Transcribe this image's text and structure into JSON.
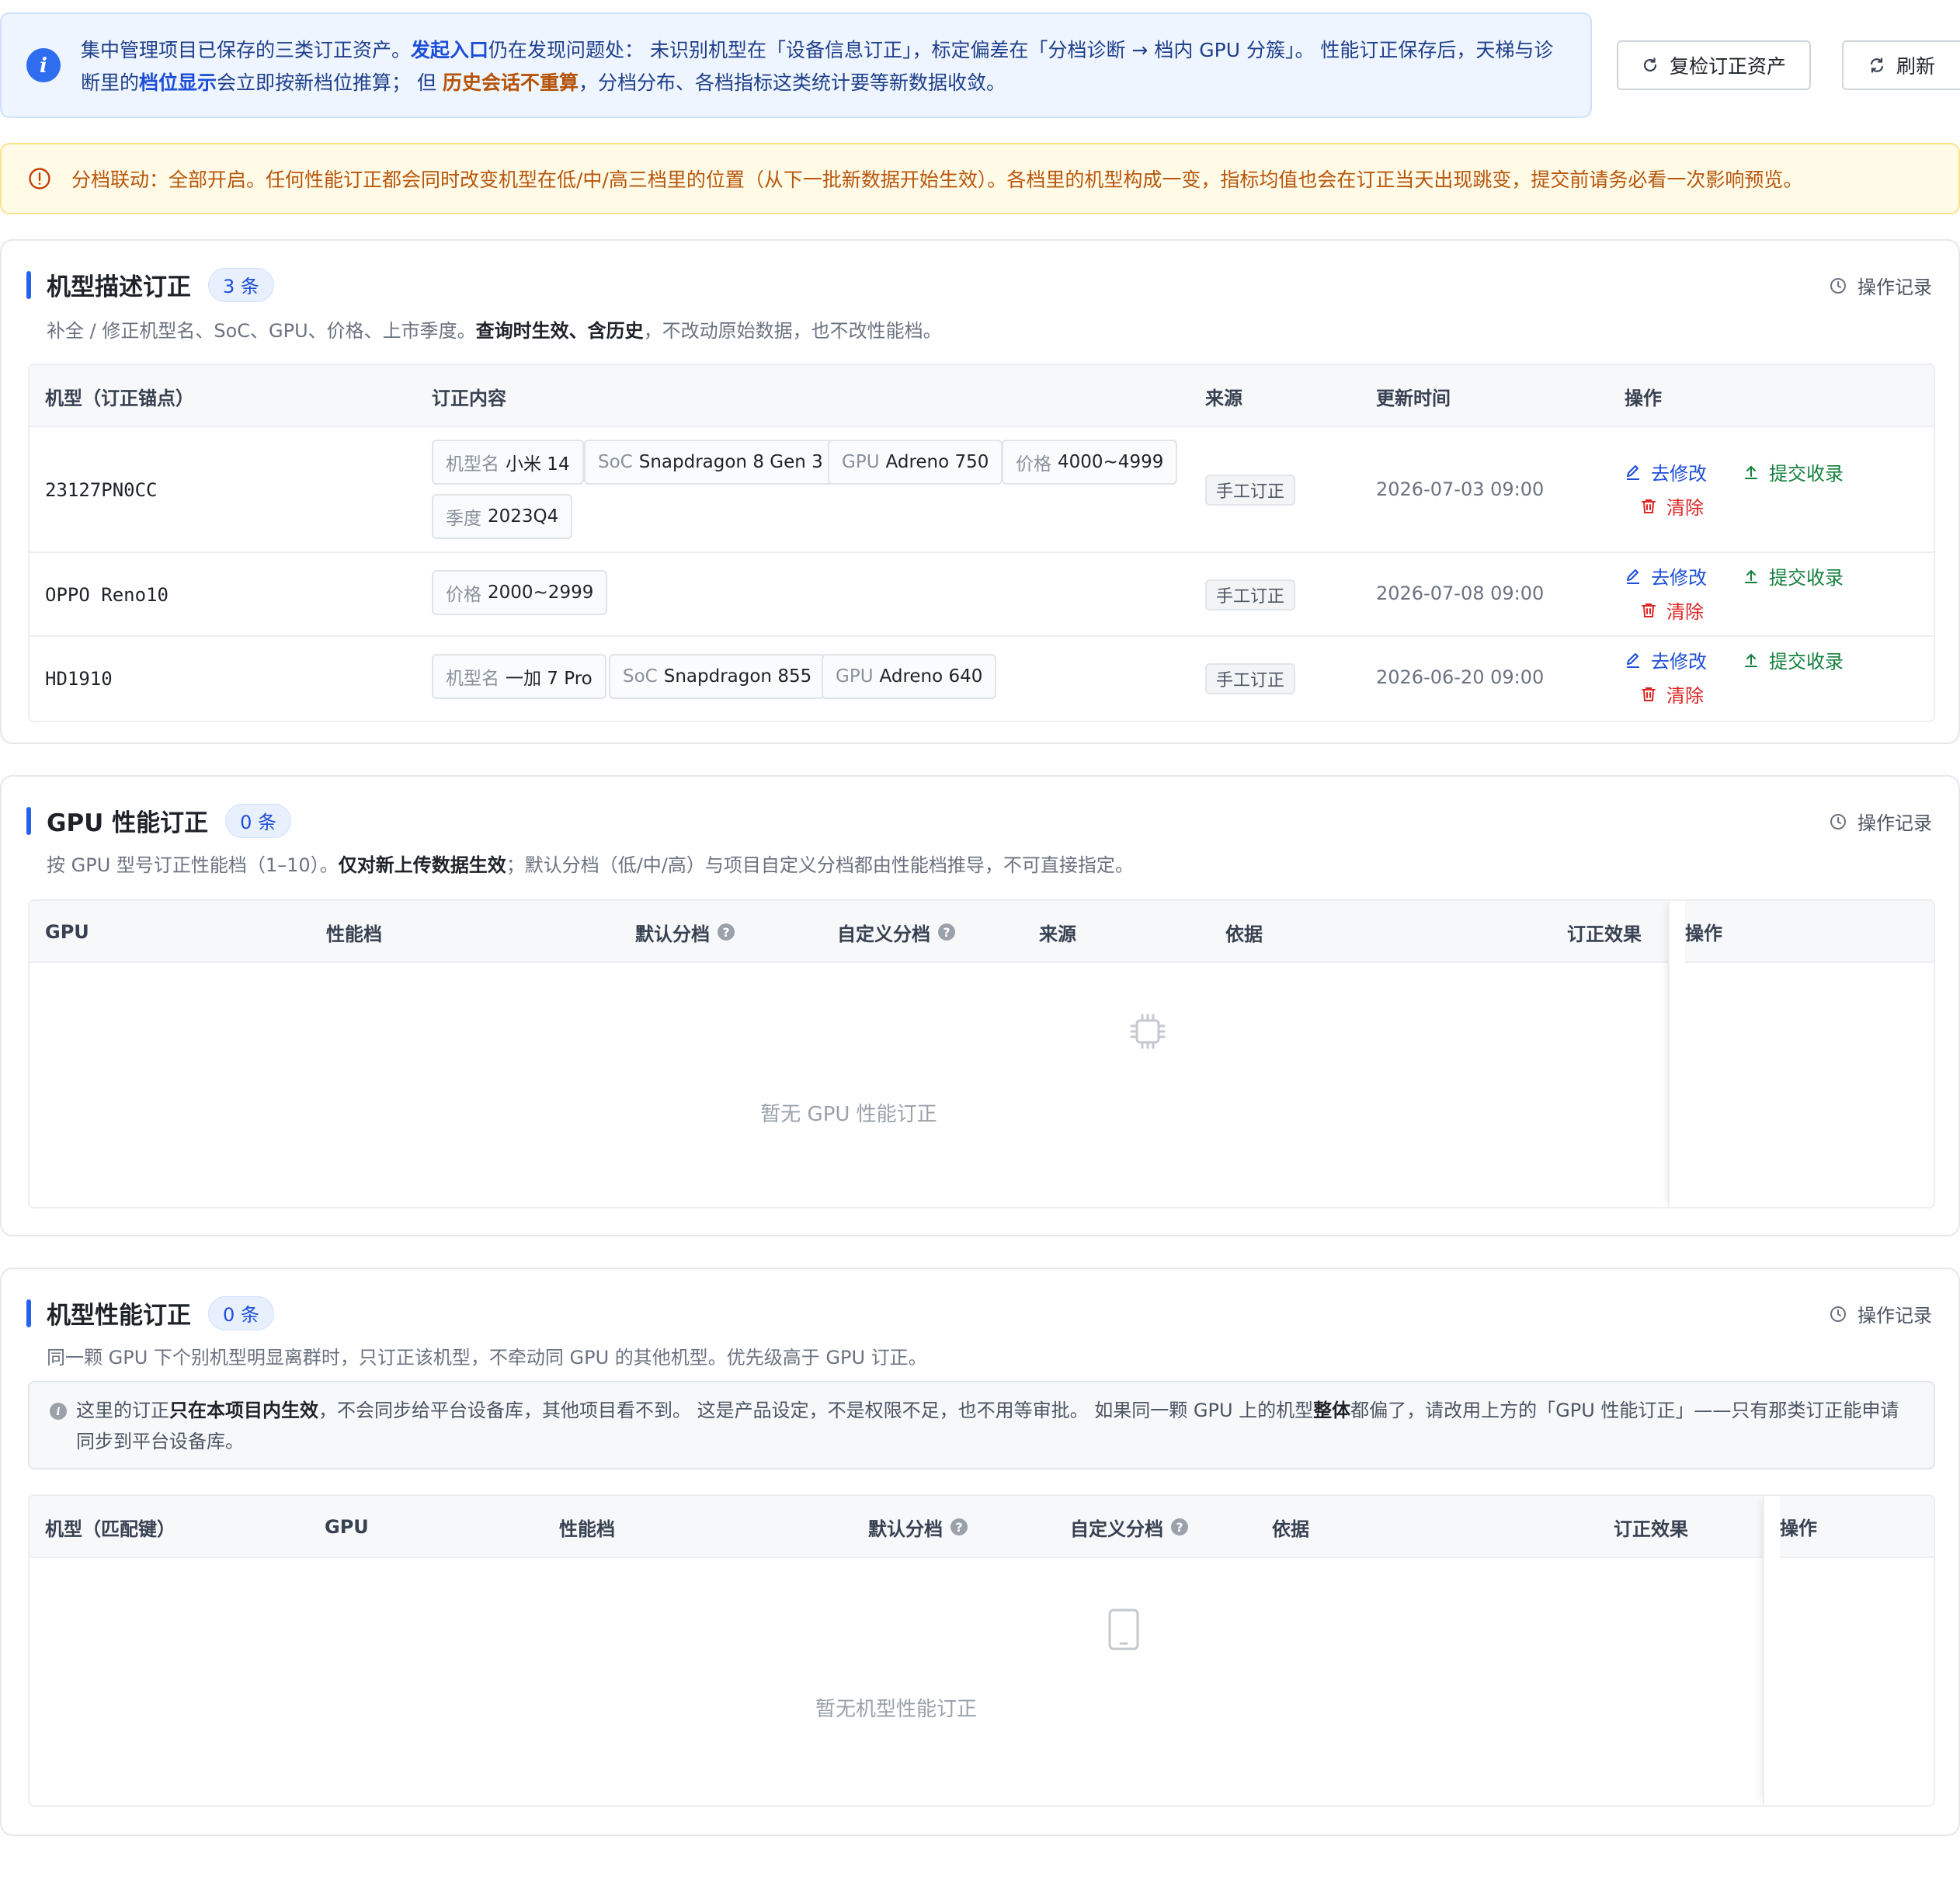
{
  "banner": {
    "p1": "集中管理项目已保存的三类订正资产。",
    "p2": "发起入口",
    "p3": "仍在发现问题处：  未识别机型在「设备信息订正」，标定偏差在「分档诊断 → 档内 GPU 分簇」。 性能订正保存后，天梯与诊断里的",
    "p4": "档位显示",
    "p5": "会立即按新档位推算；  但 ",
    "p6": "历史会话不重算",
    "p7": "，分档分布、各档指标这类统计要等新数据收敛。",
    "recheck_label": "复检订正资产",
    "refresh_label": "刷新"
  },
  "warning": {
    "text": "分档联动：全部开启。任何性能订正都会同时改变机型在低/中/高三档里的位置（从下一批新数据开始生效）。各档里的机型构成一变，指标均值也会在订正当天出现跳变，提交前请务必看一次影响预览。"
  },
  "ops_log_label": "操作记录",
  "sec1": {
    "title": "机型描述订正",
    "count": "3 条",
    "desc_a": "补全 / 修正机型名、SoC、GPU、价格、上市季度。",
    "desc_b": "查询时生效、含历史",
    "desc_c": "，不改动原始数据，也不改性能档。",
    "headers": [
      "机型（订正锚点）",
      "订正内容",
      "来源",
      "更新时间",
      "操作"
    ],
    "rows": [
      {
        "model": "23127PN0CC",
        "chips": [
          {
            "k": "机型名",
            "v": "小米 14"
          },
          {
            "k": "SoC",
            "v": "Snapdragon 8 Gen 3"
          },
          {
            "k": "GPU",
            "v": "Adreno 750"
          },
          {
            "k": "价格",
            "v": "4000~4999"
          },
          {
            "k": "季度",
            "v": "2023Q4"
          }
        ],
        "source": "手工订正",
        "time": "2026-07-03 09:00"
      },
      {
        "model": "OPPO Reno10",
        "chips": [
          {
            "k": "价格",
            "v": "2000~2999"
          }
        ],
        "source": "手工订正",
        "time": "2026-07-08 09:00"
      },
      {
        "model": "HD1910",
        "chips": [
          {
            "k": "机型名",
            "v": "一加 7 Pro"
          },
          {
            "k": "SoC",
            "v": "Snapdragon 855"
          },
          {
            "k": "GPU",
            "v": "Adreno 640"
          }
        ],
        "source": "手工订正",
        "time": "2026-06-20 09:00"
      }
    ],
    "actions": {
      "edit": "去修改",
      "submit": "提交收录",
      "clear": "清除"
    }
  },
  "sec2": {
    "title": "GPU 性能订正",
    "count": "0 条",
    "desc_a": "按 GPU 型号订正性能档（1–10）。",
    "desc_b": "仅对新上传数据生效",
    "desc_c": "；默认分档（低/中/高）与项目自定义分档都由性能档推导，不可直接指定。",
    "headers": [
      "GPU",
      "性能档",
      "默认分档",
      "自定义分档",
      "来源",
      "依据",
      "订正效果",
      "操作"
    ],
    "empty": "暂无 GPU 性能订正"
  },
  "sec3": {
    "title": "机型性能订正",
    "count": "0 条",
    "desc": "同一颗 GPU 下个别机型明显离群时，只订正该机型，不牵动同 GPU 的其他机型。优先级高于 GPU 订正。",
    "note_a": "这里的订正",
    "note_b": "只在本项目内生效",
    "note_c": "，不会同步给平台设备库，其他项目看不到。 这是产品设定，不是权限不足，也不用等审批。 如果同一颗 GPU 上的机型",
    "note_d": "整体",
    "note_e": "都偏了，请改用上方的「GPU 性能订正」——只有那类订正能申请同步到平台设备库。",
    "headers": [
      "机型（匹配键）",
      "GPU",
      "性能档",
      "默认分档",
      "自定义分档",
      "依据",
      "订正效果",
      "操作"
    ],
    "empty": "暂无机型性能订正"
  },
  "colors": {
    "accent": "#2563eb",
    "success": "#15803d",
    "danger": "#dc2626",
    "warning": "#b8560c"
  }
}
